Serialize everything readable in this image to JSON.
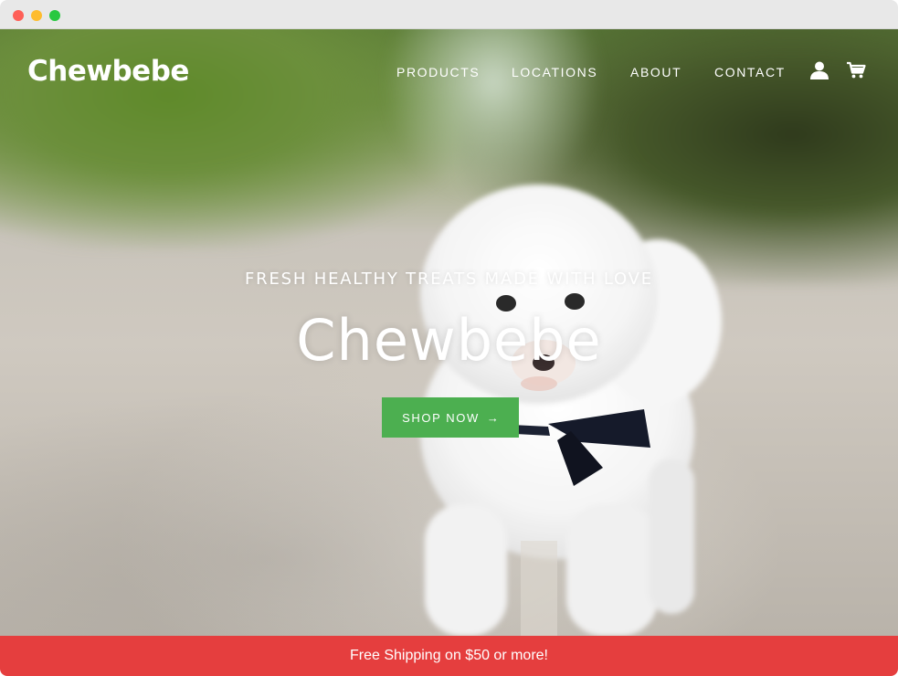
{
  "window": {
    "controls": [
      "close",
      "minimize",
      "maximize"
    ]
  },
  "header": {
    "logo": "Chewbebe",
    "nav": [
      {
        "label": "PRODUCTS"
      },
      {
        "label": "LOCATIONS"
      },
      {
        "label": "ABOUT"
      },
      {
        "label": "CONTACT"
      }
    ],
    "icons": [
      "account-icon",
      "cart-icon"
    ]
  },
  "hero": {
    "tagline": "FRESH HEALTHY TREATS MADE WITH LOVE",
    "title": "Chewbebe",
    "cta_label": "SHOP NOW",
    "cta_arrow": "→",
    "image": "white-dog-photo"
  },
  "promo": {
    "text": "Free Shipping on $50 or more!"
  },
  "colors": {
    "cta": "#4caf50",
    "promo_bar": "#e53e3e",
    "text_on_hero": "#ffffff"
  }
}
